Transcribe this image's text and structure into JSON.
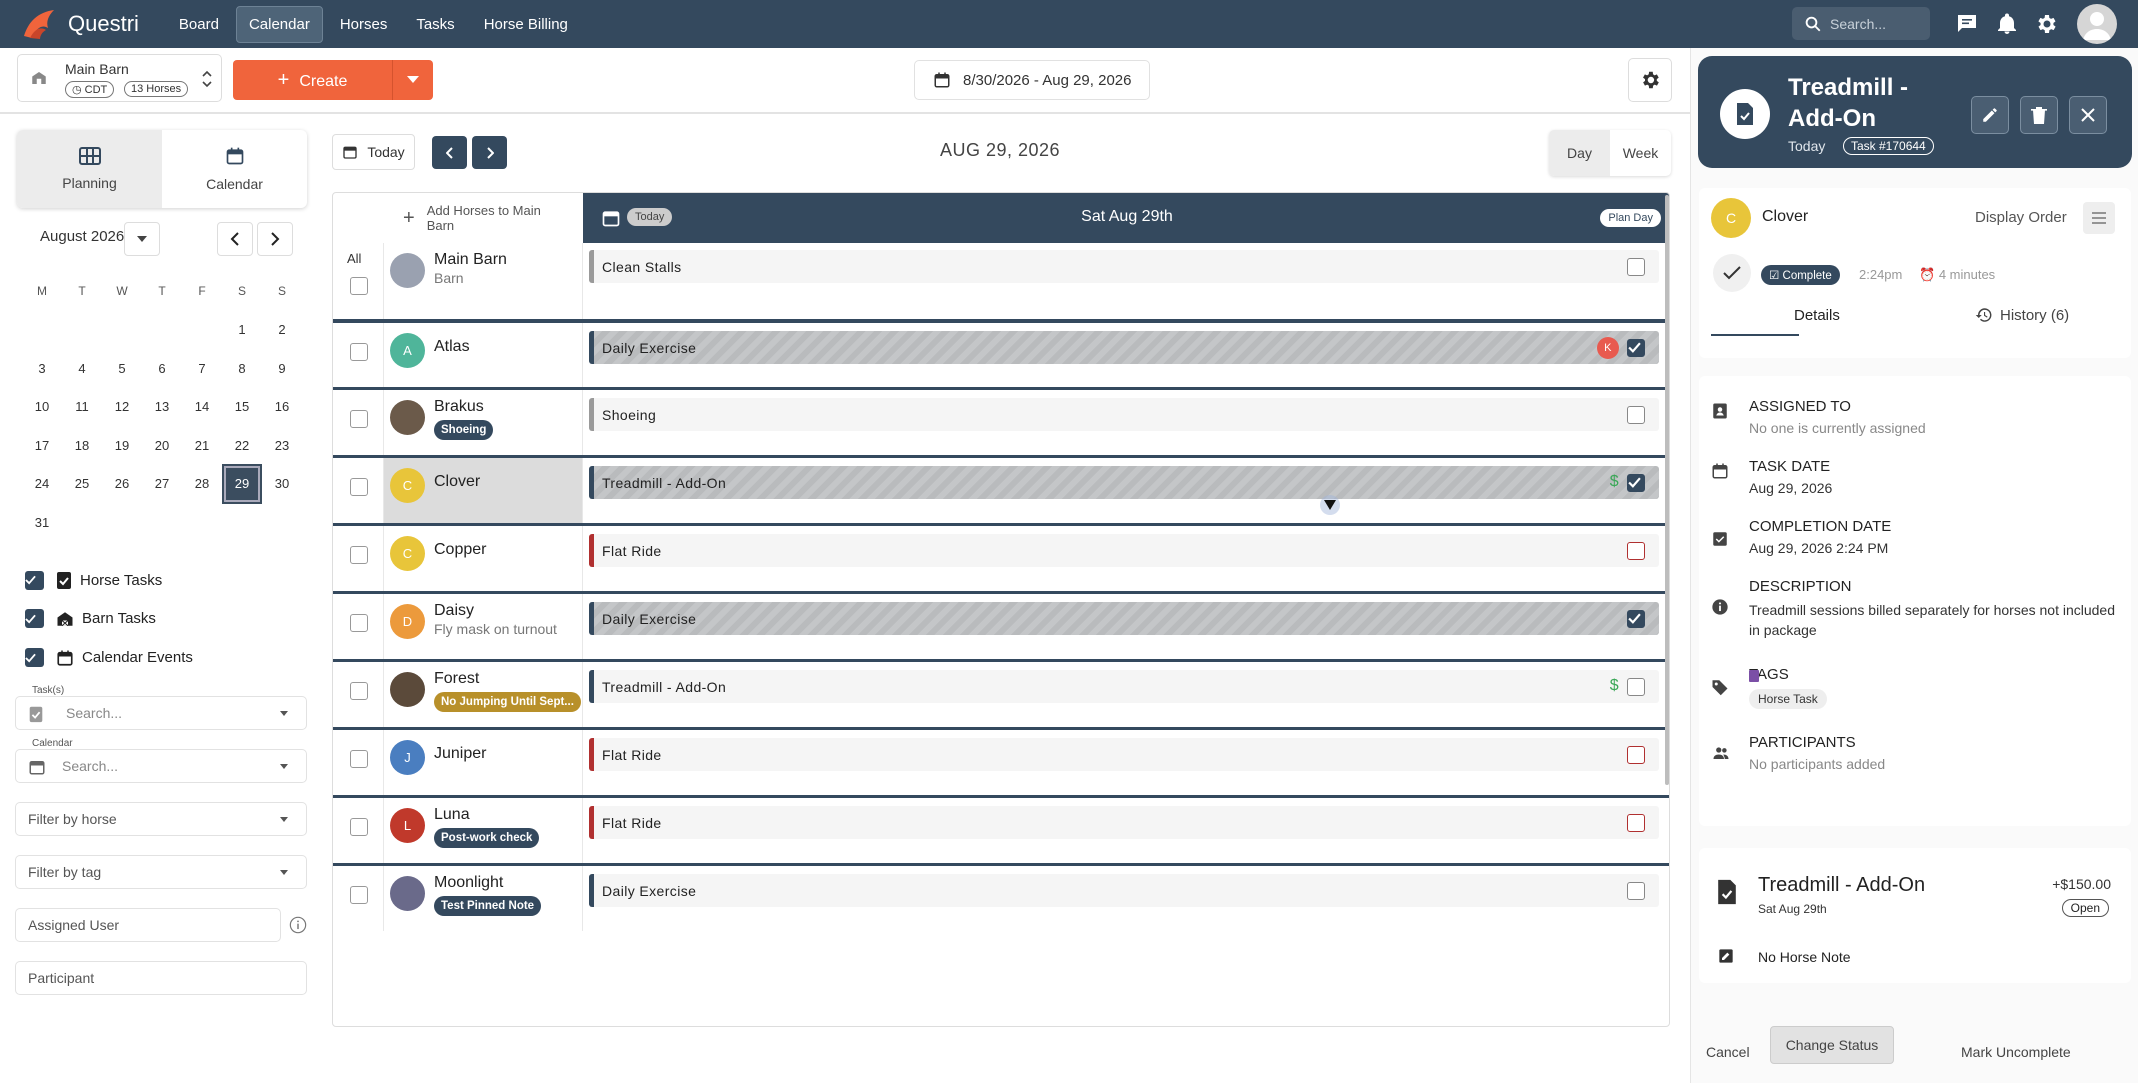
{
  "nav": {
    "app_name": "Questri",
    "items": [
      "Board",
      "Calendar",
      "Horses",
      "Tasks",
      "Horse Billing"
    ],
    "active": "Calendar",
    "search_placeholder": "Search..."
  },
  "toolbar": {
    "barn_name": "Main Barn",
    "timezone": "CDT",
    "horse_count": "13 Horses",
    "create_label": "Create",
    "date_range": "8/30/2026 - Aug 29, 2026"
  },
  "sidebar": {
    "tabs": [
      "Planning",
      "Calendar"
    ],
    "month_label": "August 2026",
    "weekdays": [
      "M",
      "T",
      "W",
      "T",
      "F",
      "S",
      "S"
    ],
    "weeks": [
      [
        "",
        "",
        "",
        "",
        "",
        "1",
        "2"
      ],
      [
        "3",
        "4",
        "5",
        "6",
        "7",
        "8",
        "9"
      ],
      [
        "10",
        "11",
        "12",
        "13",
        "14",
        "15",
        "16"
      ],
      [
        "17",
        "18",
        "19",
        "20",
        "21",
        "22",
        "23"
      ],
      [
        "24",
        "25",
        "26",
        "27",
        "28",
        "29",
        "30"
      ],
      [
        "31",
        "",
        "",
        "",
        "",
        "",
        ""
      ]
    ],
    "selected_day": "29",
    "filters": [
      "Horse Tasks",
      "Barn Tasks",
      "Calendar Events"
    ],
    "tasks_label": "Task(s)",
    "tasks_placeholder": "Search...",
    "calendar_label": "Calendar",
    "calendar_placeholder": "Search...",
    "filter_horse": "Filter by horse",
    "filter_tag": "Filter by tag",
    "assigned_user": "Assigned User",
    "participant": "Participant"
  },
  "schedule": {
    "today_btn": "Today",
    "center_date": "AUG 29, 2026",
    "view_day": "Day",
    "view_week": "Week",
    "add_horses": "Add Horses to Main Barn",
    "today_tag": "Today",
    "day_title": "Sat Aug 29th",
    "plan_day": "Plan Day",
    "all_label": "All",
    "rows": [
      {
        "name": "Main Barn",
        "sub": "Barn",
        "initial": "",
        "color": "#9aa1b0",
        "note": "",
        "task": "Clean Stalls"
      },
      {
        "name": "Atlas",
        "sub": "",
        "initial": "A",
        "color": "#4fb59a",
        "note": "",
        "task": "Daily Exercise",
        "assignee": "K"
      },
      {
        "name": "Brakus",
        "sub": "",
        "initial": "",
        "color": "#6b5a4a",
        "note": "Shoeing",
        "task": "Shoeing"
      },
      {
        "name": "Clover",
        "sub": "",
        "initial": "C",
        "color": "#e8c53a",
        "note": "",
        "task": "Treadmill - Add-On",
        "price": "$"
      },
      {
        "name": "Copper",
        "sub": "",
        "initial": "C",
        "color": "#e8c53a",
        "note": "",
        "task": "Flat Ride"
      },
      {
        "name": "Daisy",
        "sub": "Fly mask on turnout",
        "initial": "D",
        "color": "#ec9a3c",
        "note": "",
        "task": "Daily Exercise"
      },
      {
        "name": "Forest",
        "sub": "",
        "initial": "",
        "color": "#5b4a3a",
        "note": "No Jumping Until Sept...",
        "task": "Treadmill - Add-On",
        "price": "$"
      },
      {
        "name": "Juniper",
        "sub": "",
        "initial": "J",
        "color": "#4a7ec0",
        "note": "",
        "task": "Flat Ride"
      },
      {
        "name": "Luna",
        "sub": "",
        "initial": "L",
        "color": "#c0392b",
        "note": "Post-work check",
        "task": "Flat Ride"
      },
      {
        "name": "Moonlight",
        "sub": "",
        "initial": "",
        "color": "#6a6a8a",
        "note": "Test Pinned Note",
        "task": "Daily Exercise"
      }
    ]
  },
  "panel": {
    "title": "Treadmill - Add-On",
    "today": "Today",
    "task_number": "Task #170644",
    "horse_initial": "C",
    "horse_name": "Clover",
    "display_order": "Display Order",
    "status": "Complete",
    "status_time": "2:24pm",
    "duration": "4 minutes",
    "tab_details": "Details",
    "tab_history": "History (6)",
    "assigned_label": "ASSIGNED TO",
    "assigned_value": "No one is currently assigned",
    "task_date_label": "TASK DATE",
    "task_date_value": "Aug 29, 2026",
    "completion_label": "COMPLETION DATE",
    "completion_value": "Aug 29, 2026 2:24 PM",
    "description_label": "DESCRIPTION",
    "description_value": "Treadmill sessions billed separately for horses not included in package",
    "tags_label": "TAGS",
    "tag": "Horse Task",
    "participants_label": "PARTICIPANTS",
    "participants_value": "No participants added",
    "billing_title": "Treadmill - Add-On",
    "billing_date": "Sat Aug 29th",
    "billing_amount": "+$150.00",
    "billing_status": "Open",
    "horse_note": "No Horse Note",
    "cancel": "Cancel",
    "change_status": "Change Status",
    "mark_uncomplete": "Mark Uncomplete"
  },
  "colors": {
    "nav": "#34495e",
    "accent": "#f0643c",
    "complete": "#34495e"
  }
}
